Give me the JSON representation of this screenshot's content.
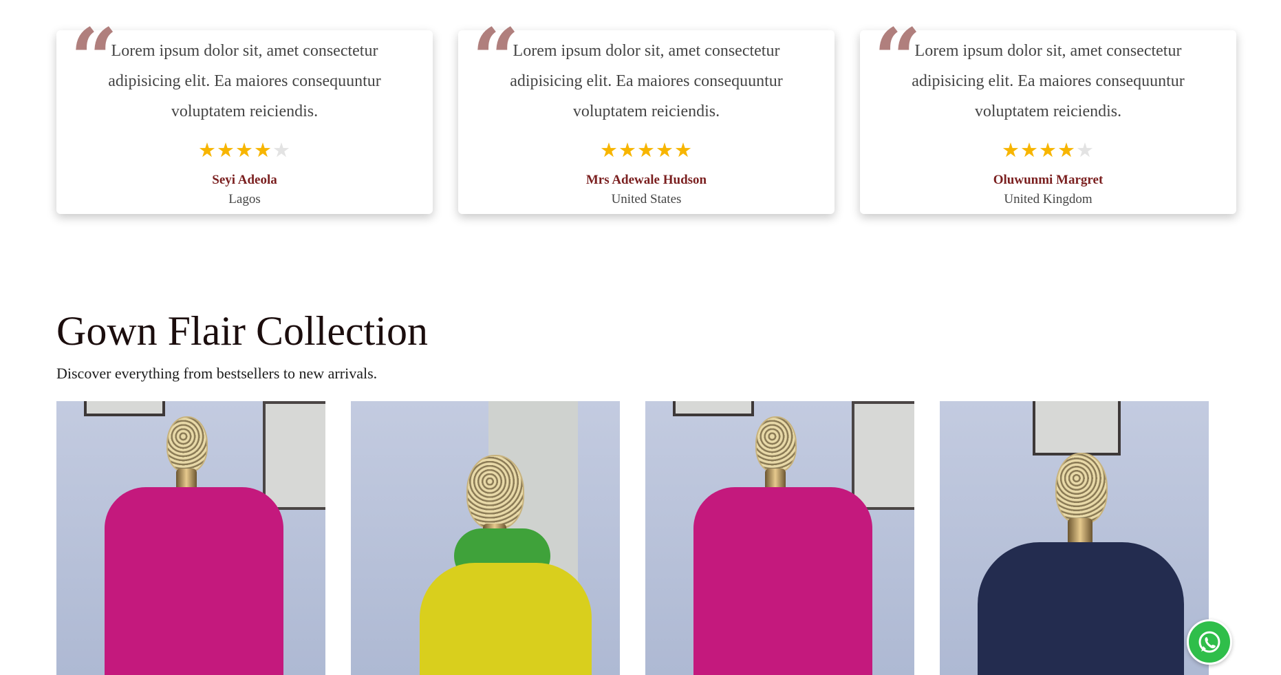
{
  "testimonials": [
    {
      "quote": "Lorem ipsum dolor sit, amet consectetur adipisicing elit. Ea maiores consequuntur voluptatem reiciendis.",
      "rating": 4,
      "name": "Seyi Adeola",
      "location": "Lagos"
    },
    {
      "quote": "Lorem ipsum dolor sit, amet consectetur adipisicing elit. Ea maiores consequuntur voluptatem reiciendis.",
      "rating": 5,
      "name": "Mrs Adewale Hudson",
      "location": "United States"
    },
    {
      "quote": "Lorem ipsum dolor sit, amet consectetur adipisicing elit. Ea maiores consequuntur voluptatem reiciendis.",
      "rating": 4,
      "name": "Oluwunmi Margret",
      "location": "United Kingdom"
    }
  ],
  "collection": {
    "title": "Gown Flair Collection",
    "subtitle": "Discover everything from bestsellers to new arrivals."
  },
  "products": [
    {
      "dress_color": "#c4197d"
    },
    {
      "dress_color": "#d9cf1d"
    },
    {
      "dress_color": "#c4197d"
    },
    {
      "dress_color": "#232c4f"
    }
  ],
  "colors": {
    "star": "#f7b500",
    "star_empty": "#e3e3e3",
    "name": "#7a1f1f",
    "quote_mark": "#b07f7d",
    "whatsapp": "#2fbe4a"
  },
  "icons": {
    "quote": "quote-icon",
    "star": "star-icon",
    "whatsapp": "whatsapp-icon"
  }
}
